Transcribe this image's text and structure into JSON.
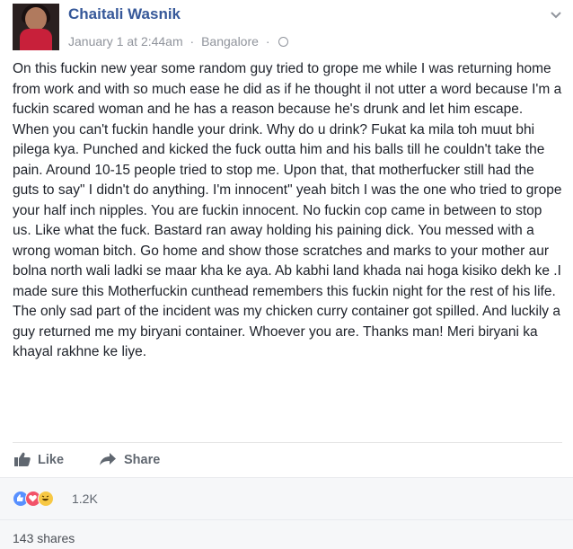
{
  "post": {
    "author": "Chaitali Wasnik",
    "timestamp": "January 1 at 2:44am",
    "location": "Bangalore",
    "separator": "·",
    "privacy_icon": "globe-icon",
    "menu_icon": "chevron-down-icon",
    "paragraphs": [
      "On this fuckin new year some random guy tried to grope me while I was returning home from work and with so much ease he did as if he thought il not utter a word because I'm a fuckin scared woman and he has a reason because he's drunk and let him escape. When you can't fuckin handle your drink. Why do u drink? Fukat ka mila toh muut bhi pilega kya. Punched and kicked the fuck outta him and his balls till he couldn't take the pain. Around 10-15 people tried to stop me. Upon that, that motherfucker still had the guts to say\" I didn't do anything. I'm innocent\" yeah bitch I was the one who tried to grope your half inch nipples. You are fuckin innocent. No fuckin cop came in between to stop us. Like what the fuck. Bastard ran away holding his paining dick. You messed with a wrong woman bitch. Go home and show those scratches and marks to your mother aur bolna north wali ladki se maar kha ke aya. Ab kabhi land khada nai hoga kisiko dekh ke .I made sure this Motherfuckin cunthead remembers this fuckin night for the rest of his life. The only sad part of the incident was my chicken curry container got spilled. And luckily a guy returned me my biryani container. Whoever you are. Thanks man! Meri biryani ka khayal rakhne ke liye."
    ]
  },
  "actions": {
    "like_label": "Like",
    "share_label": "Share"
  },
  "reactions": {
    "types": [
      "like",
      "love",
      "haha"
    ],
    "count": "1.2K"
  },
  "shares": {
    "label": "143 shares"
  },
  "colors": {
    "author_link": "#365899",
    "meta_text": "#90949c",
    "like_reaction": "#5890ff",
    "love_reaction": "#f25268",
    "haha_reaction": "#f7c844",
    "footer_bg": "#f6f7f9"
  }
}
